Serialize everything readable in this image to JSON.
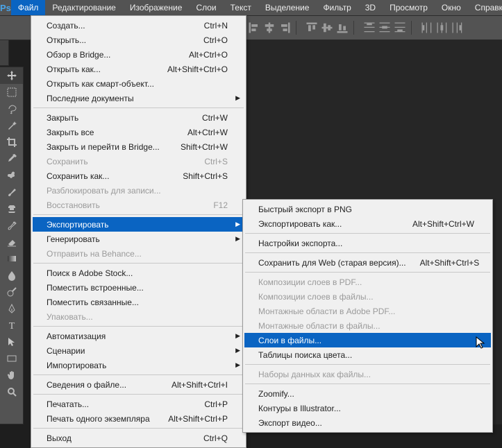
{
  "app": {
    "logo": "Ps"
  },
  "menubar": [
    "Файл",
    "Редактирование",
    "Изображение",
    "Слои",
    "Текст",
    "Выделение",
    "Фильтр",
    "3D",
    "Просмотр",
    "Окно",
    "Справка"
  ],
  "file_menu": [
    {
      "label": "Создать...",
      "shortcut": "Ctrl+N"
    },
    {
      "label": "Открыть...",
      "shortcut": "Ctrl+O"
    },
    {
      "label": "Обзор в Bridge...",
      "shortcut": "Alt+Ctrl+O"
    },
    {
      "label": "Открыть как...",
      "shortcut": "Alt+Shift+Ctrl+O"
    },
    {
      "label": "Открыть как смарт-объект..."
    },
    {
      "label": "Последние документы",
      "submenu": true
    },
    {
      "sep": true
    },
    {
      "label": "Закрыть",
      "shortcut": "Ctrl+W"
    },
    {
      "label": "Закрыть все",
      "shortcut": "Alt+Ctrl+W"
    },
    {
      "label": "Закрыть и перейти в Bridge...",
      "shortcut": "Shift+Ctrl+W"
    },
    {
      "label": "Сохранить",
      "shortcut": "Ctrl+S",
      "disabled": true
    },
    {
      "label": "Сохранить как...",
      "shortcut": "Shift+Ctrl+S"
    },
    {
      "label": "Разблокировать для записи...",
      "disabled": true
    },
    {
      "label": "Восстановить",
      "shortcut": "F12",
      "disabled": true
    },
    {
      "sep": true
    },
    {
      "label": "Экспортировать",
      "submenu": true,
      "hl": true
    },
    {
      "label": "Генерировать",
      "submenu": true
    },
    {
      "label": "Отправить на Behance...",
      "disabled": true
    },
    {
      "sep": true
    },
    {
      "label": "Поиск в Adobe Stock..."
    },
    {
      "label": "Поместить встроенные..."
    },
    {
      "label": "Поместить связанные..."
    },
    {
      "label": "Упаковать...",
      "disabled": true
    },
    {
      "sep": true
    },
    {
      "label": "Автоматизация",
      "submenu": true
    },
    {
      "label": "Сценарии",
      "submenu": true
    },
    {
      "label": "Импортировать",
      "submenu": true
    },
    {
      "sep": true
    },
    {
      "label": "Сведения о файле...",
      "shortcut": "Alt+Shift+Ctrl+I"
    },
    {
      "sep": true
    },
    {
      "label": "Печатать...",
      "shortcut": "Ctrl+P"
    },
    {
      "label": "Печать одного экземпляра",
      "shortcut": "Alt+Shift+Ctrl+P"
    },
    {
      "sep": true
    },
    {
      "label": "Выход",
      "shortcut": "Ctrl+Q"
    }
  ],
  "export_menu": [
    {
      "label": "Быстрый экспорт в PNG"
    },
    {
      "label": "Экспортировать как...",
      "shortcut": "Alt+Shift+Ctrl+W"
    },
    {
      "sep": true
    },
    {
      "label": "Настройки экспорта..."
    },
    {
      "sep": true
    },
    {
      "label": "Сохранить для Web (старая версия)...",
      "shortcut": "Alt+Shift+Ctrl+S"
    },
    {
      "sep": true
    },
    {
      "label": "Композиции слоев в PDF...",
      "disabled": true
    },
    {
      "label": "Композиции слоев в файлы...",
      "disabled": true
    },
    {
      "label": "Монтажные области в Adobe PDF...",
      "disabled": true
    },
    {
      "label": "Монтажные области в файлы...",
      "disabled": true
    },
    {
      "label": "Слои в файлы...",
      "hl": true
    },
    {
      "label": "Таблицы поиска цвета..."
    },
    {
      "sep": true
    },
    {
      "label": "Наборы данных как файлы...",
      "disabled": true
    },
    {
      "sep": true
    },
    {
      "label": "Zoomify..."
    },
    {
      "label": "Контуры в Illustrator..."
    },
    {
      "label": "Экспорт видео..."
    }
  ]
}
